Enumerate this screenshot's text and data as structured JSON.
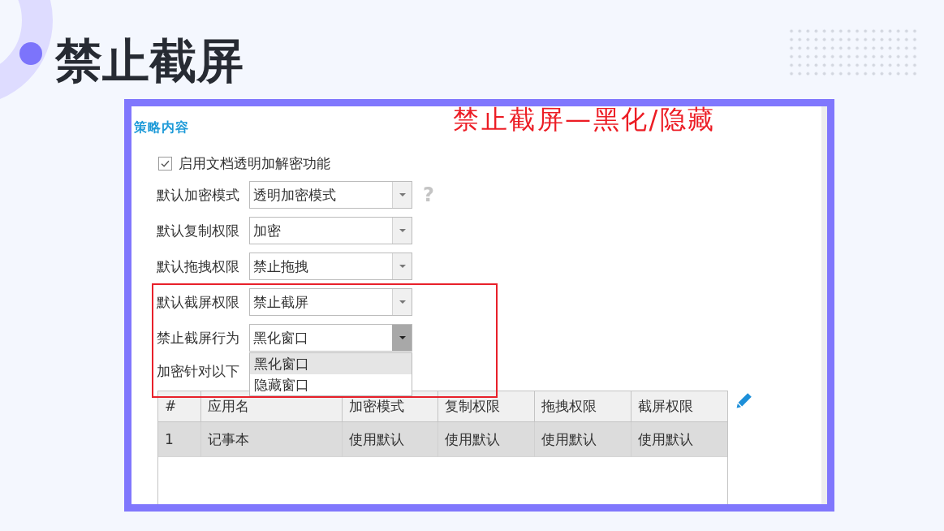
{
  "slide": {
    "title": "禁止截屏"
  },
  "screenshot": {
    "section_title": "策略内容",
    "annotation": "禁止截屏—黑化/隐藏",
    "transparent_encryption": {
      "label": "启用文档透明加解密功能",
      "checked": true
    },
    "settings": [
      {
        "label": "默认加密模式",
        "value": "透明加密模式",
        "expanded": false,
        "help": "?"
      },
      {
        "label": "默认复制权限",
        "value": "加密",
        "expanded": false
      },
      {
        "label": "默认拖拽权限",
        "value": "禁止拖拽",
        "expanded": false
      },
      {
        "label": "默认截屏权限",
        "value": "禁止截屏",
        "expanded": false
      },
      {
        "label": "禁止截屏行为",
        "value": "黑化窗口",
        "expanded": true,
        "options": [
          {
            "label": "黑化窗口",
            "selected": true
          },
          {
            "label": "隐藏窗口",
            "selected": false
          }
        ]
      }
    ],
    "program_list_label": "加密针对以下",
    "table": {
      "columns": [
        "#",
        "应用名",
        "加密模式",
        "复制权限",
        "拖拽权限",
        "截屏权限"
      ],
      "rows": [
        {
          "cells": [
            "1",
            "记事本",
            "使用默认",
            "使用默认",
            "使用默认",
            "使用默认"
          ],
          "selected": true
        }
      ]
    }
  }
}
